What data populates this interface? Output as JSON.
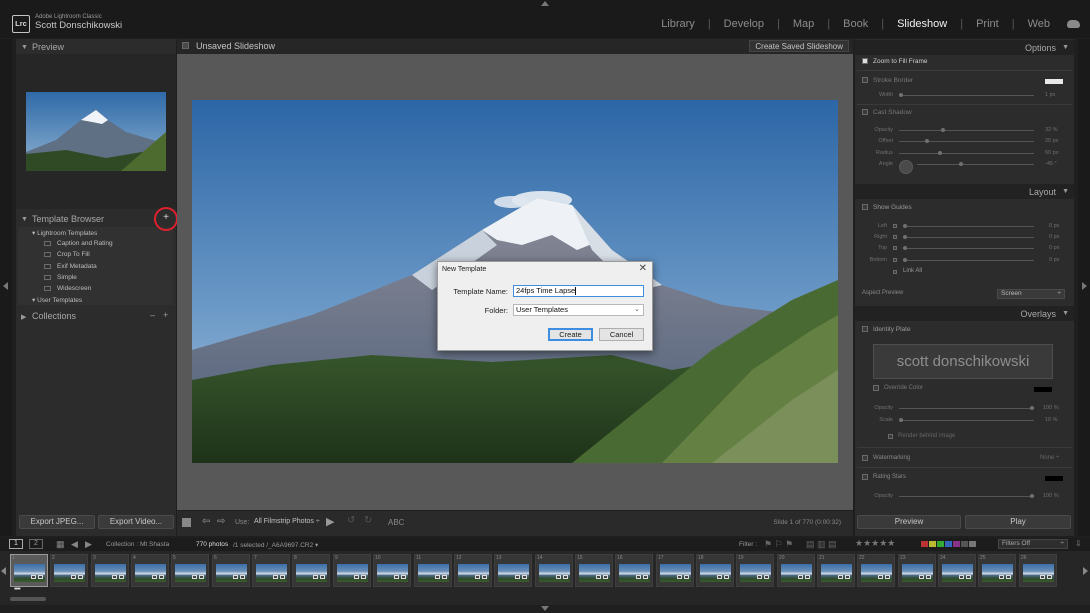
{
  "app": {
    "logo": "Lrc",
    "name": "Adobe Lightroom Classic",
    "user": "Scott Donschikowski"
  },
  "modules": [
    {
      "label": "Library",
      "active": false
    },
    {
      "label": "Develop",
      "active": false
    },
    {
      "label": "Map",
      "active": false
    },
    {
      "label": "Book",
      "active": false
    },
    {
      "label": "Slideshow",
      "active": true
    },
    {
      "label": "Print",
      "active": false
    },
    {
      "label": "Web",
      "active": false
    }
  ],
  "left_panel": {
    "preview_title": "Preview",
    "template_browser_title": "Template Browser",
    "add_label": "+",
    "lightroom_templates": "Lightroom Templates",
    "templates": [
      "Caption and Rating",
      "Crop To Fill",
      "Exif Metadata",
      "Simple",
      "Widescreen"
    ],
    "user_templates": "User Templates",
    "collections_title": "Collections",
    "collections_minus": "–",
    "collections_plus": "+",
    "export_jpeg": "Export JPEG...",
    "export_video": "Export Video..."
  },
  "center": {
    "title": "Unsaved Slideshow",
    "create_saved": "Create Saved Slideshow",
    "use_label": "Use:",
    "use_value": "All Filmstrip Photos",
    "abc_label": "ABC",
    "slide_info": "Slide 1 of 770 (0:00:32)"
  },
  "right_panel": {
    "options_title": "Options",
    "zoom_to_fill": "Zoom to Fill Frame",
    "stroke_border": "Stroke Border",
    "width_label": "Width",
    "width_value": "1 px",
    "cast_shadow": "Cast Shadow",
    "opacity_label": "Opacity",
    "opacity_value": "32 %",
    "offset_label": "Offset",
    "offset_value": "20 px",
    "radius_label": "Radius",
    "radius_value": "60 px",
    "angle_label": "Angle",
    "angle_value": "-45 °",
    "layout_title": "Layout",
    "show_guides": "Show Guides",
    "left_label": "Left",
    "left_value": "0 px",
    "right_label": "Right",
    "right_value": "0 px",
    "top_label": "Top",
    "top_value": "0 px",
    "bottom_label": "Bottom",
    "bottom_value": "0 px",
    "link_all": "Link All",
    "aspect_preview": "Aspect Preview",
    "aspect_value": "Screen",
    "overlays_title": "Overlays",
    "identity_plate": "Identity Plate",
    "identity_text": "scott donschikowski",
    "override_color": "Override Color",
    "ip_opacity_label": "Opacity",
    "ip_opacity_value": "100 %",
    "scale_label": "Scale",
    "scale_value": "10 %",
    "render_behind": "Render behind image",
    "watermarking": "Watermarking",
    "watermark_value": "None ÷",
    "rating_stars": "Rating Stars",
    "rs_opacity_label": "Opacity",
    "rs_opacity_value": "100 %",
    "preview_btn": "Preview",
    "play_btn": "Play"
  },
  "filmstrip": {
    "page1": "1",
    "page2": "2",
    "collection": "Collection : Mt Shasta",
    "count": "770 photos",
    "selected": "/1 selected /_A6A9697.CR2",
    "filter_label": "Filter :",
    "filter_value": "Filters Off",
    "cell_numbers": [
      "1",
      "2",
      "3",
      "4",
      "5",
      "6",
      "7",
      "8",
      "9",
      "10",
      "11",
      "12",
      "13",
      "14",
      "15",
      "16",
      "17",
      "18",
      "19",
      "20",
      "21",
      "22",
      "23",
      "24",
      "25",
      "26"
    ]
  },
  "dialog": {
    "title": "New Template",
    "close": "✕",
    "name_label": "Template Name:",
    "name_value": "24fps Time Lapse",
    "folder_label": "Folder:",
    "folder_value": "User Templates",
    "create": "Create",
    "cancel": "Cancel"
  },
  "colors": {
    "accent_ring": "#e0202c",
    "dialog_focus": "#3d8ee0",
    "active_module": "#f2f2f2"
  }
}
